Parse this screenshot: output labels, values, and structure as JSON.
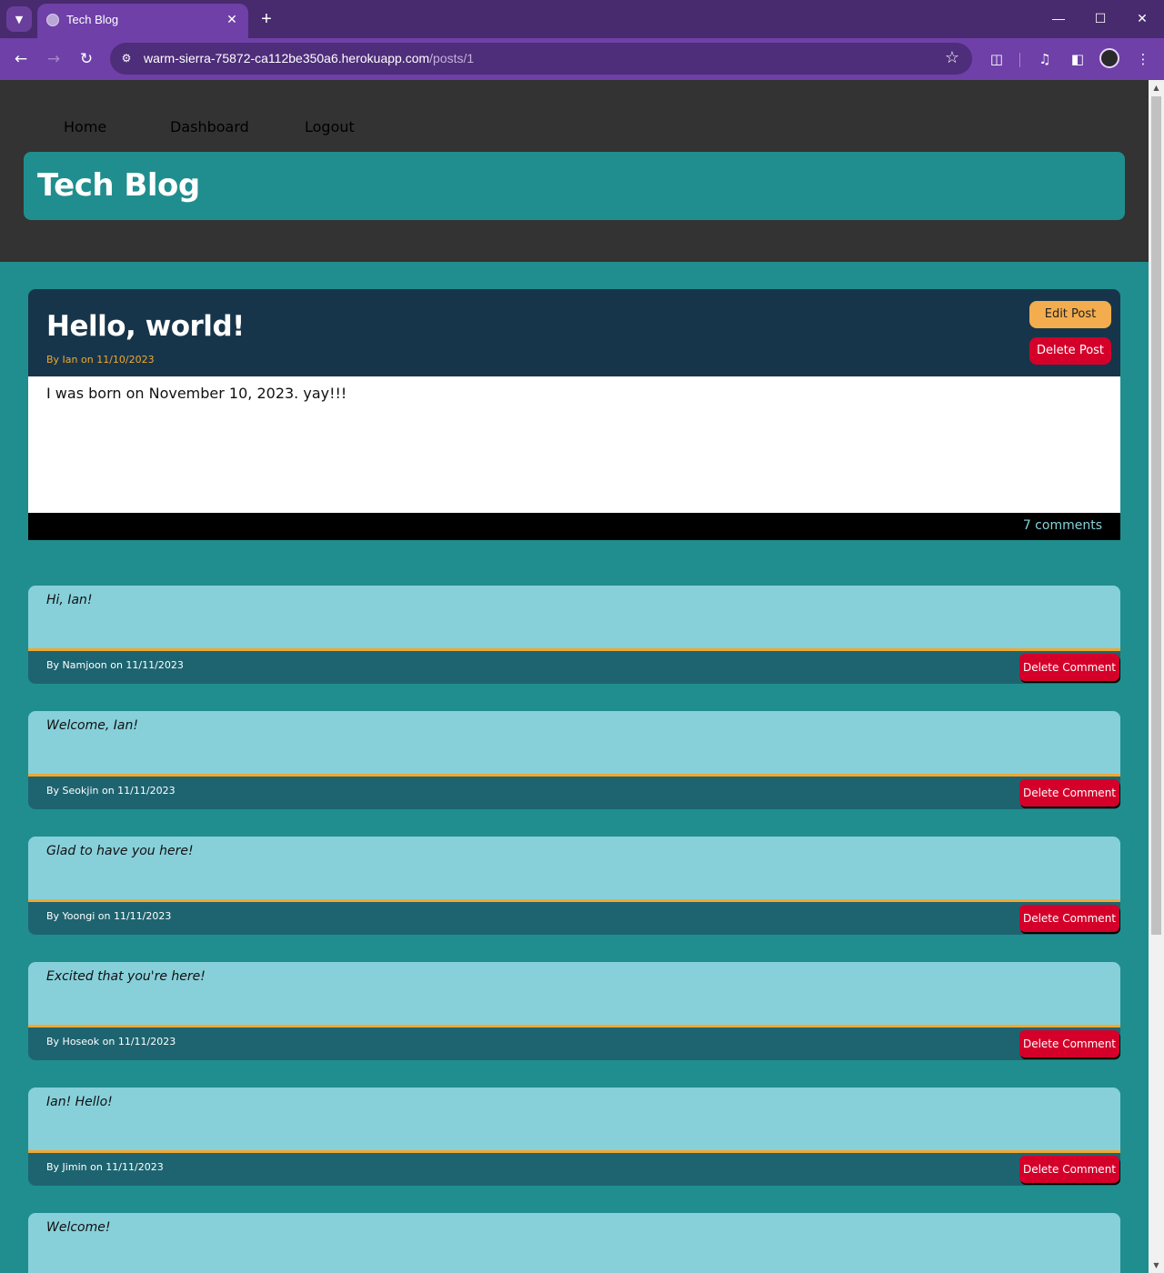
{
  "browser": {
    "tab_title": "Tech Blog",
    "url_host": "warm-sierra-75872-ca112be350a6.herokuapp.com",
    "url_path": "/posts/1"
  },
  "nav": {
    "home": "Home",
    "dashboard": "Dashboard",
    "logout": "Logout"
  },
  "site": {
    "title": "Tech Blog"
  },
  "post": {
    "title": "Hello, world!",
    "meta": "By Ian on 11/10/2023",
    "content": "I was born on November 10, 2023. yay!!!",
    "edit_label": "Edit Post",
    "delete_label": "Delete Post",
    "comment_count": "7 comments"
  },
  "comments": [
    {
      "text": "Hi, Ian!",
      "meta": "By Namjoon on 11/11/2023",
      "delete_label": "Delete Comment"
    },
    {
      "text": "Welcome, Ian!",
      "meta": "By Seokjin on 11/11/2023",
      "delete_label": "Delete Comment"
    },
    {
      "text": "Glad to have you here!",
      "meta": "By Yoongi on 11/11/2023",
      "delete_label": "Delete Comment"
    },
    {
      "text": "Excited that you're here!",
      "meta": "By Hoseok on 11/11/2023",
      "delete_label": "Delete Comment"
    },
    {
      "text": "Ian! Hello!",
      "meta": "By Jimin on 11/11/2023",
      "delete_label": "Delete Comment"
    },
    {
      "text": "Welcome!"
    }
  ],
  "colors": {
    "chrome_purple": "#6e40a8",
    "header_bg": "#333333",
    "teal": "#208e8e",
    "post_head": "#17354a",
    "edit_orange": "#f3ad4e",
    "delete_red": "#d4002a",
    "comment_bg": "#87d0da",
    "comment_foot": "#1e6470"
  }
}
